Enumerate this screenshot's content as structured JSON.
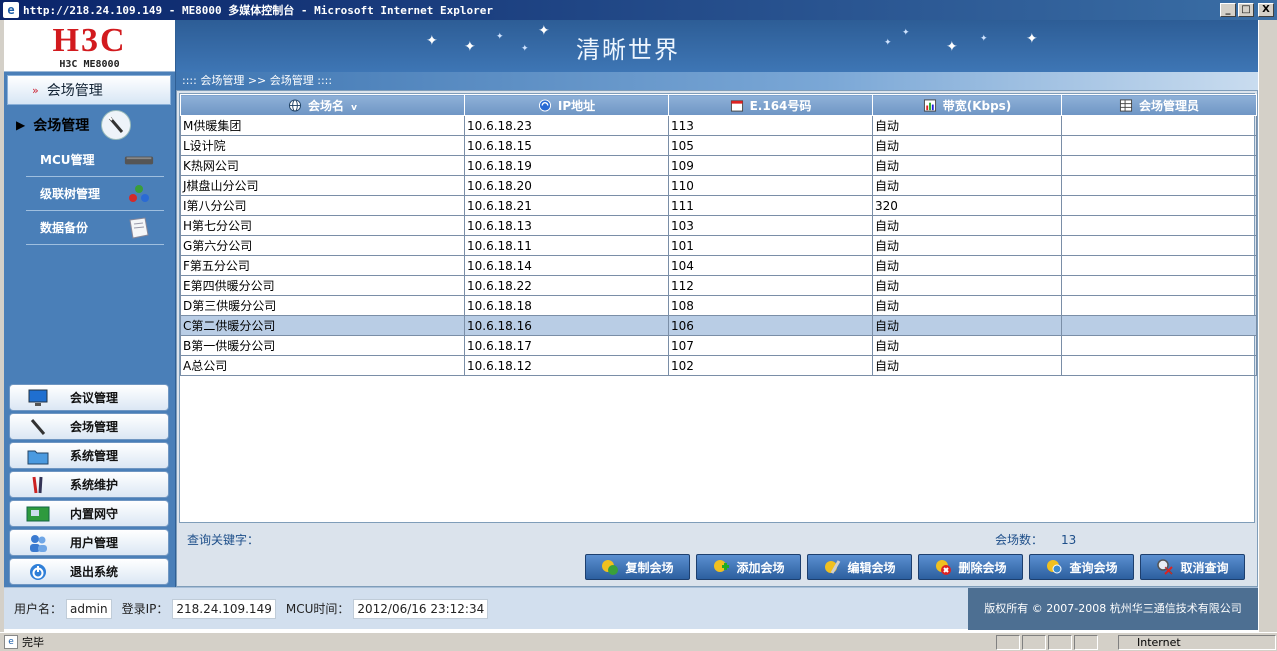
{
  "window": {
    "title": "http://218.24.109.149 - ME8000 多媒体控制台 - Microsoft Internet Explorer",
    "min": "_",
    "max": "□",
    "close": "X"
  },
  "logo": {
    "brand": "H3C",
    "product": "H3C ME8000"
  },
  "banner": {
    "slogan": "清晰世界"
  },
  "breadcrumb": ":::: 会场管理 >> 会场管理 ::::",
  "sidebar": {
    "header": "会场管理",
    "active_category": "会场管理",
    "sub_items": [
      {
        "label": "MCU管理",
        "icon": "mcu-device-icon"
      },
      {
        "label": "级联树管理",
        "icon": "cascade-tree-icon"
      },
      {
        "label": "数据备份",
        "icon": "data-backup-icon"
      }
    ],
    "menu": [
      {
        "label": "会议管理",
        "icon": "monitor-icon"
      },
      {
        "label": "会场管理",
        "icon": "wand-icon"
      },
      {
        "label": "系统管理",
        "icon": "folder-icon"
      },
      {
        "label": "系统维护",
        "icon": "tools-icon"
      },
      {
        "label": "内置网守",
        "icon": "network-card-icon"
      },
      {
        "label": "用户管理",
        "icon": "users-icon"
      },
      {
        "label": "退出系统",
        "icon": "power-icon"
      }
    ]
  },
  "table": {
    "columns": [
      "会场名",
      "IP地址",
      "E.164号码",
      "带宽(Kbps)",
      "会场管理员"
    ],
    "sort_indicator": "v",
    "selected_row": 10,
    "rows": [
      [
        "M供暖集团",
        "10.6.18.23",
        "113",
        "自动",
        ""
      ],
      [
        "L设计院",
        "10.6.18.15",
        "105",
        "自动",
        ""
      ],
      [
        "K热网公司",
        "10.6.18.19",
        "109",
        "自动",
        ""
      ],
      [
        "J棋盘山分公司",
        "10.6.18.20",
        "110",
        "自动",
        ""
      ],
      [
        "I第八分公司",
        "10.6.18.21",
        "111",
        "320",
        ""
      ],
      [
        "H第七分公司",
        "10.6.18.13",
        "103",
        "自动",
        ""
      ],
      [
        "G第六分公司",
        "10.6.18.11",
        "101",
        "自动",
        ""
      ],
      [
        "F第五分公司",
        "10.6.18.14",
        "104",
        "自动",
        ""
      ],
      [
        "E第四供暖分公司",
        "10.6.18.22",
        "112",
        "自动",
        ""
      ],
      [
        "D第三供暖分公司",
        "10.6.18.18",
        "108",
        "自动",
        ""
      ],
      [
        "C第二供暖分公司",
        "10.6.18.16",
        "106",
        "自动",
        ""
      ],
      [
        "B第一供暖分公司",
        "10.6.18.17",
        "107",
        "自动",
        ""
      ],
      [
        "A总公司",
        "10.6.18.12",
        "102",
        "自动",
        ""
      ]
    ]
  },
  "query": {
    "label": "查询关键字："
  },
  "count": {
    "label": "会场数：",
    "value": "13"
  },
  "actions": [
    {
      "label": "复制会场",
      "icon": "copy-icon"
    },
    {
      "label": "添加会场",
      "icon": "add-icon"
    },
    {
      "label": "编辑会场",
      "icon": "edit-icon"
    },
    {
      "label": "删除会场",
      "icon": "delete-icon"
    },
    {
      "label": "查询会场",
      "icon": "query-icon"
    },
    {
      "label": "取消查询",
      "icon": "cancel-query-icon"
    }
  ],
  "footer": {
    "user_label": "用户名：",
    "user": "admin",
    "ip_label": "登录IP：",
    "ip": "218.24.109.149",
    "time_label": "MCU时间：",
    "time": "2012/06/16 23:12:34",
    "copyright": "版权所有 © 2007-2008 杭州华三通信技术有限公司"
  },
  "statusbar": {
    "text": "完毕",
    "zone": "Internet"
  },
  "colors": {
    "accent": "#3e76b5",
    "brand": "#d21a1e",
    "selected_row": "#b9cde5"
  }
}
